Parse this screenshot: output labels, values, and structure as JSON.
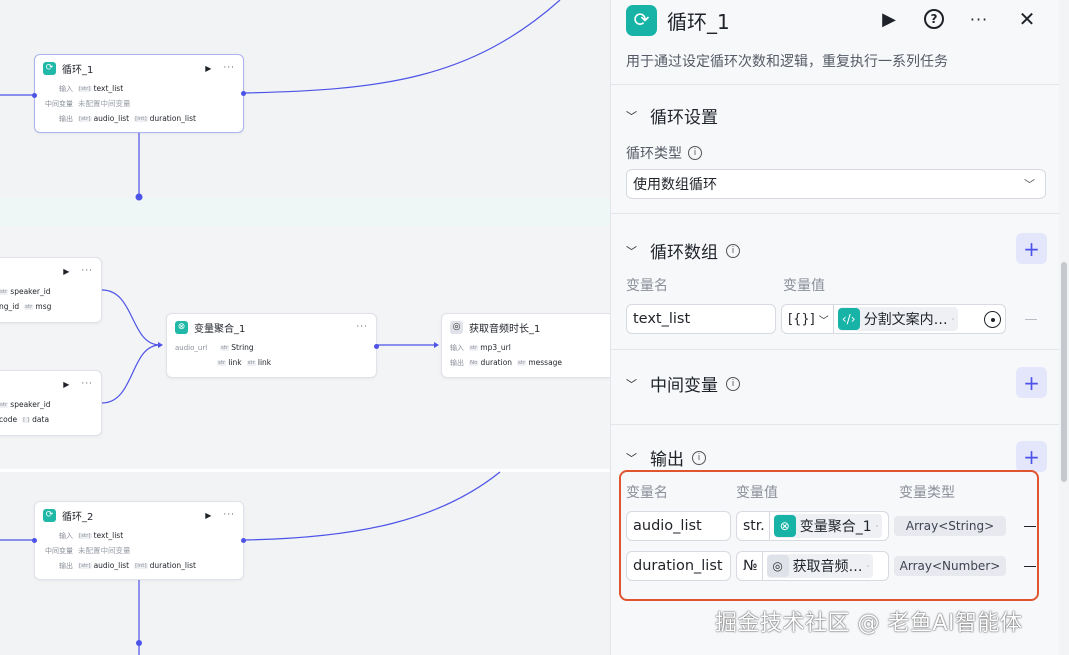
{
  "canvas": {
    "loop1": {
      "title": "循环_1",
      "input_label": "输入",
      "input_type": "[str]",
      "input_value": "text_list",
      "mid_label": "中间变量",
      "mid_value": "未配置中间变量",
      "output_label": "输出",
      "out1_type": "[str]",
      "out1": "audio_list",
      "out2_type": "[int]",
      "out2": "duration_list"
    },
    "node_a": {
      "f1_type": "str",
      "f1": "speaker_id",
      "f2": "ng_id",
      "f3_type": "str",
      "f3": "msg"
    },
    "node_b": {
      "f1_type": "str",
      "f1": "speaker_id",
      "f2": "code",
      "f3_type": "[ ]",
      "f3": "data"
    },
    "agg": {
      "title": "变量聚合_1",
      "in_label": "audio_url",
      "in_type": "str",
      "in_value": "String",
      "o1_type": "str",
      "o1": "link",
      "o2_type": "str",
      "o2": "link"
    },
    "dur": {
      "title": "获取音频时长_1",
      "input_label": "输入",
      "in_type": "str",
      "in_value": "mp3_url",
      "output_label": "输出",
      "o1_type": "No",
      "o1": "duration",
      "o2_type": "str",
      "o2": "message"
    },
    "loop2": {
      "title": "循环_2",
      "input_label": "输入",
      "input_type": "[str]",
      "input_value": "text_list",
      "mid_label": "中间变量",
      "mid_value": "未配置中间变量",
      "output_label": "输出",
      "out1_type": "[str]",
      "out1": "audio_list",
      "out2_type": "[int]",
      "out2": "duration_list"
    }
  },
  "panel": {
    "title": "循环_1",
    "description": "用于通过设定循环次数和逻辑，重复执行一系列任务",
    "icons": {
      "node": "loop-icon",
      "run": "play-icon",
      "help": "help-icon",
      "more": "more-icon",
      "close": "close-icon"
    },
    "loop_settings": {
      "title": "循环设置",
      "type_label": "循环类型",
      "type_value": "使用数组循环"
    },
    "loop_array": {
      "title": "循环数组",
      "col_name": "变量名",
      "col_value": "变量值",
      "row": {
        "name": "text_list",
        "type_icon": "[{}]",
        "ref": "分割文案内…"
      }
    },
    "mid_vars": {
      "title": "中间变量"
    },
    "output": {
      "title": "输出",
      "col_name": "变量名",
      "col_value": "变量值",
      "col_type": "变量类型",
      "rows": [
        {
          "name": "audio_list",
          "type_icon": "str.",
          "ref": "变量聚合_1",
          "var_type": "Array<String>"
        },
        {
          "name": "duration_list",
          "type_icon": "№",
          "ref": "获取音频…",
          "var_type": "Array<Number>"
        }
      ]
    }
  },
  "watermark": "掘金技术社区 @ 老鱼AI智能体",
  "colors": {
    "accent": "#4d53e8",
    "teal": "#17b3a7",
    "highlight": "#e0552f"
  }
}
